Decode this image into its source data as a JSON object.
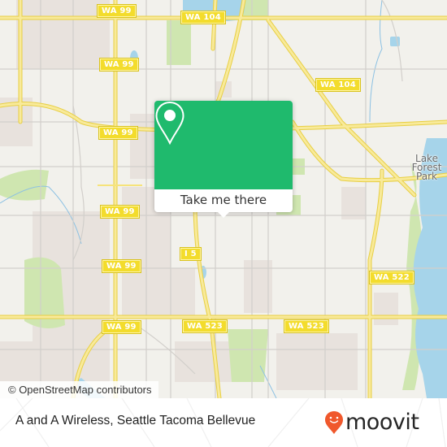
{
  "map": {
    "colors": {
      "background": "#f2f1ec",
      "urban": "#e8e2dd",
      "park": "#cfe6b0",
      "water": "#a6d4ea",
      "highway": "#f6e37a",
      "highway_edge": "#e8cf44",
      "minor_road": "#d2cfcb",
      "stream": "#8cc1e3"
    },
    "shields": [
      {
        "label": "WA 99"
      },
      {
        "label": "WA 104"
      },
      {
        "label": "WA 99"
      },
      {
        "label": "WA 104"
      },
      {
        "label": "WA 99"
      },
      {
        "label": "WA 99"
      },
      {
        "label": "WA 99"
      },
      {
        "label": "I 5"
      },
      {
        "label": "WA 99"
      },
      {
        "label": "WA 522"
      },
      {
        "label": "WA 99"
      },
      {
        "label": "WA 523"
      },
      {
        "label": "WA 523"
      }
    ],
    "places": [
      {
        "label": "Lake Forest Park"
      }
    ],
    "attribution": "© OpenStreetMap contributors"
  },
  "popup": {
    "accent_color": "#1fba6d",
    "icon": "map-pin-icon",
    "cta_label": "Take me there"
  },
  "footer": {
    "title": "A and A Wireless, Seattle Tacoma Bellevue",
    "brand": {
      "name": "moovit",
      "icon": "moovit-pin-icon",
      "color": "#f0582c"
    }
  }
}
